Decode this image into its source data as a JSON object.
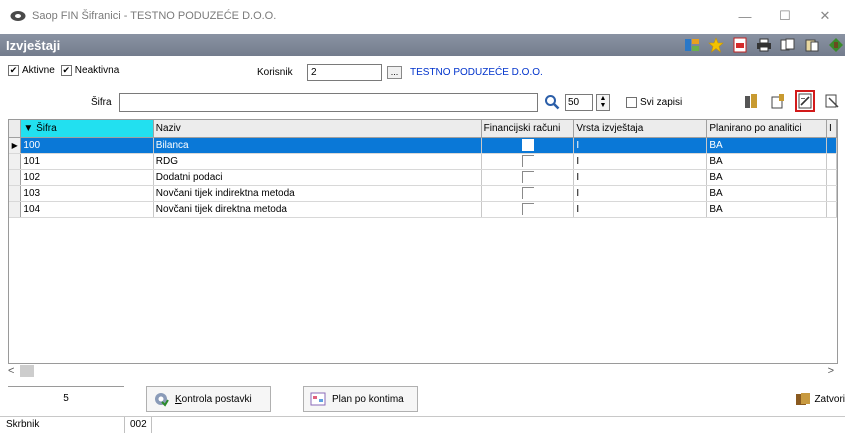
{
  "window": {
    "title": "Saop FIN Šifranici - TESTNO PODUZEĆE D.O.O.",
    "minimize": "—",
    "maximize": "☐",
    "close": "✕"
  },
  "header": {
    "title": "Izvještaji"
  },
  "filters": {
    "aktivne_label": "Aktivne",
    "aktivne_checked": true,
    "neaktivna_label": "Neaktivna",
    "neaktivna_checked": true,
    "korisnik_label": "Korisnik",
    "korisnik_value": "2",
    "dots_label": "...",
    "korisnik_name": "TESTNO PODUZEĆE D.O.O."
  },
  "search": {
    "sifra_label": "Šifra",
    "sifra_value": "",
    "count_value": "50",
    "svi_zapisi_label": "Svi zapisi",
    "svi_zapisi_checked": false
  },
  "grid": {
    "columns": [
      "▼ Šifra",
      "Naziv",
      "Financijski računi",
      "Vrsta izvještaja",
      "Planirano po analitici",
      "I"
    ],
    "rows": [
      {
        "sifra": "100",
        "naziv": "Bilanca",
        "vrsta": "I",
        "planirano": "BA",
        "selected": true
      },
      {
        "sifra": "101",
        "naziv": "RDG",
        "vrsta": "I",
        "planirano": "BA",
        "selected": false
      },
      {
        "sifra": "102",
        "naziv": "Dodatni podaci",
        "vrsta": "I",
        "planirano": "BA",
        "selected": false
      },
      {
        "sifra": "103",
        "naziv": "Novčani tijek indirektna metoda",
        "vrsta": "I",
        "planirano": "BA",
        "selected": false
      },
      {
        "sifra": "104",
        "naziv": "Novčani tijek direktna metoda",
        "vrsta": "I",
        "planirano": "BA",
        "selected": false
      }
    ],
    "row_indicator": "▶"
  },
  "scroll": {
    "left": "<",
    "right": ">"
  },
  "bottom": {
    "count": "5",
    "kontrola_prefix": "K",
    "kontrola_rest": "ontrola postavki",
    "plan_label": "Plan po kontima",
    "zatvori_label": "Zatvori"
  },
  "status": {
    "left": "Skrbnik",
    "right": "002"
  }
}
